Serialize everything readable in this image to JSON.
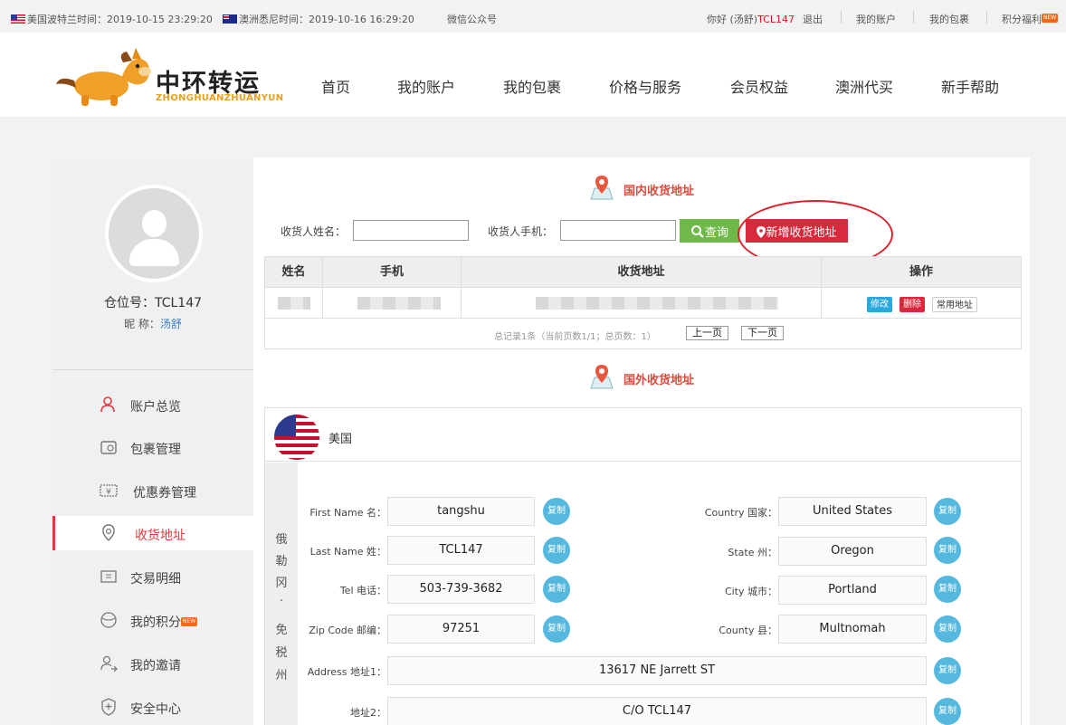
{
  "topbar": {
    "us_time": "美国波特兰时间：2019-10-15 23:29:20",
    "au_time": "澳洲悉尼时间：2019-10-16 16:29:20",
    "wechat": "微信公众号",
    "greeting_prefix": "你好",
    "user": "(汤舒)",
    "user_code": "TCL147",
    "logout": "退出",
    "my_account": "我的账户",
    "my_package": "我的包裹",
    "points": "积分福利",
    "new_badge": "NEW"
  },
  "header": {
    "logo_cn": "中环转运",
    "logo_en": "ZHONGHUANZHUANYUN",
    "nav": [
      "首页",
      "我的账户",
      "我的包裹",
      "价格与服务",
      "会员权益",
      "澳洲代买",
      "新手帮助"
    ]
  },
  "sidebar": {
    "warehouse": "仓位号：TCL147",
    "nick_label": "昵 称：",
    "nick": "汤舒",
    "items": [
      {
        "label": "账户总览",
        "icon": "user-icon"
      },
      {
        "label": "包裹管理",
        "icon": "package-icon"
      },
      {
        "label": "优惠券管理",
        "icon": "coupon-icon"
      },
      {
        "label": "收货地址",
        "icon": "location-icon"
      },
      {
        "label": "交易明细",
        "icon": "transaction-icon"
      },
      {
        "label": "我的积分",
        "icon": "points-icon",
        "badge": "NEW"
      },
      {
        "label": "我的邀请",
        "icon": "invite-icon"
      },
      {
        "label": "安全中心",
        "icon": "shield-icon"
      }
    ]
  },
  "domestic": {
    "title": "国内收货地址",
    "name_label": "收货人姓名：",
    "phone_label": "收货人手机：",
    "query": "查询",
    "add": "新增收货地址",
    "columns": [
      "姓名",
      "手机",
      "收货地址",
      "操作"
    ],
    "ops": {
      "edit": "修改",
      "delete": "删除",
      "default": "常用地址"
    },
    "pager_text": "总记录1条（当前页数1/1；总页数：1）",
    "prev": "上一页",
    "next": "下一页"
  },
  "foreign": {
    "title": "国外收货地址",
    "country": "美国",
    "state_chars": [
      "俄",
      "勒",
      "冈",
      "·",
      "免",
      "税",
      "州"
    ],
    "copy": "复制",
    "fields": {
      "first_name": {
        "label": "First Name 名：",
        "value": "tangshu"
      },
      "last_name": {
        "label": "Last Name 姓：",
        "value": "TCL147"
      },
      "tel": {
        "label": "Tel 电话：",
        "value": "503-739-3682"
      },
      "zip": {
        "label": "Zip Code 邮编：",
        "value": "97251"
      },
      "country": {
        "label": "Country 国家：",
        "value": "United States"
      },
      "state": {
        "label": "State 州：",
        "value": "Oregon"
      },
      "city": {
        "label": "City 城市：",
        "value": "Portland"
      },
      "county": {
        "label": "County 县：",
        "value": "Multnomah"
      },
      "address1": {
        "label": "Address 地址1：",
        "value": "13617 NE Jarrett ST"
      },
      "address2": {
        "label": "地址2：",
        "value": "C/O TCL147"
      }
    }
  },
  "colors": {
    "accent_red": "#d9293c",
    "green": "#6fb94a",
    "copy_blue": "#55b8de",
    "title_red": "#e04a3a"
  }
}
